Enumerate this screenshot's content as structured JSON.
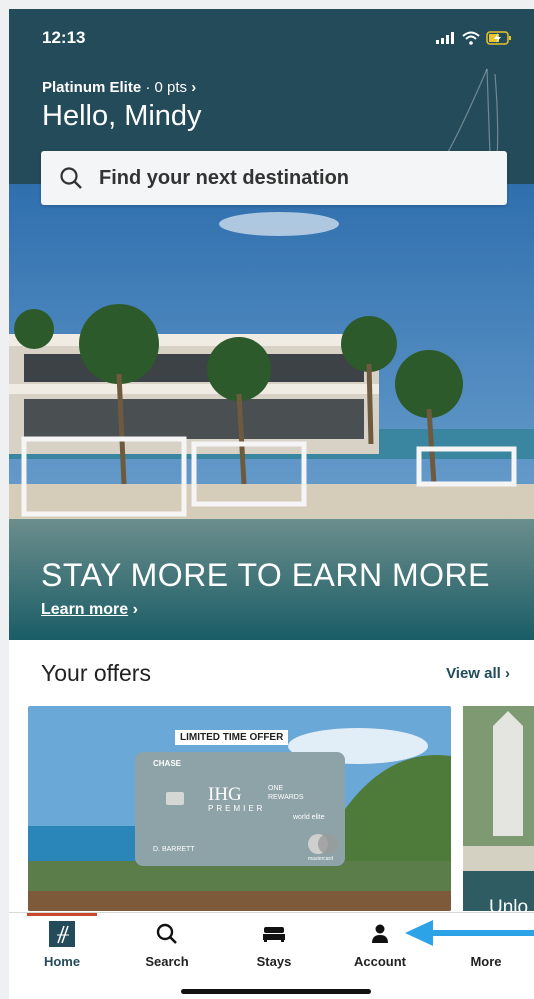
{
  "status_bar": {
    "time": "12:13"
  },
  "header": {
    "tier": "Platinum Elite",
    "points": "· 0 pts",
    "chevron": "›",
    "greeting": "Hello, Mindy"
  },
  "search": {
    "placeholder": "Find your next destination"
  },
  "hero": {
    "title": "STAY MORE TO EARN MORE",
    "link": "Learn more",
    "link_chevron": "›"
  },
  "offers": {
    "title": "Your offers",
    "view_all": "View all",
    "view_all_chevron": "›",
    "card": {
      "badge": "LIMITED TIME OFFER",
      "bank": "CHASE",
      "brand": "IHG",
      "program_line1": "ONE",
      "program_line2": "REWARDS",
      "tier": "PREMIER",
      "card_tier": "world elite",
      "holder": "D. BARRETT",
      "network": "mastercard"
    },
    "second_card_text": "Unlo"
  },
  "nav": {
    "items": [
      {
        "label": "Home",
        "icon": "ihg-home-icon"
      },
      {
        "label": "Search",
        "icon": "search-icon"
      },
      {
        "label": "Stays",
        "icon": "bed-icon"
      },
      {
        "label": "Account",
        "icon": "person-icon"
      },
      {
        "label": "More",
        "icon": "more-icon"
      }
    ]
  },
  "colors": {
    "header_bg": "#234b5a",
    "accent": "#c9492c",
    "annotation_arrow": "#2ba3e6"
  }
}
